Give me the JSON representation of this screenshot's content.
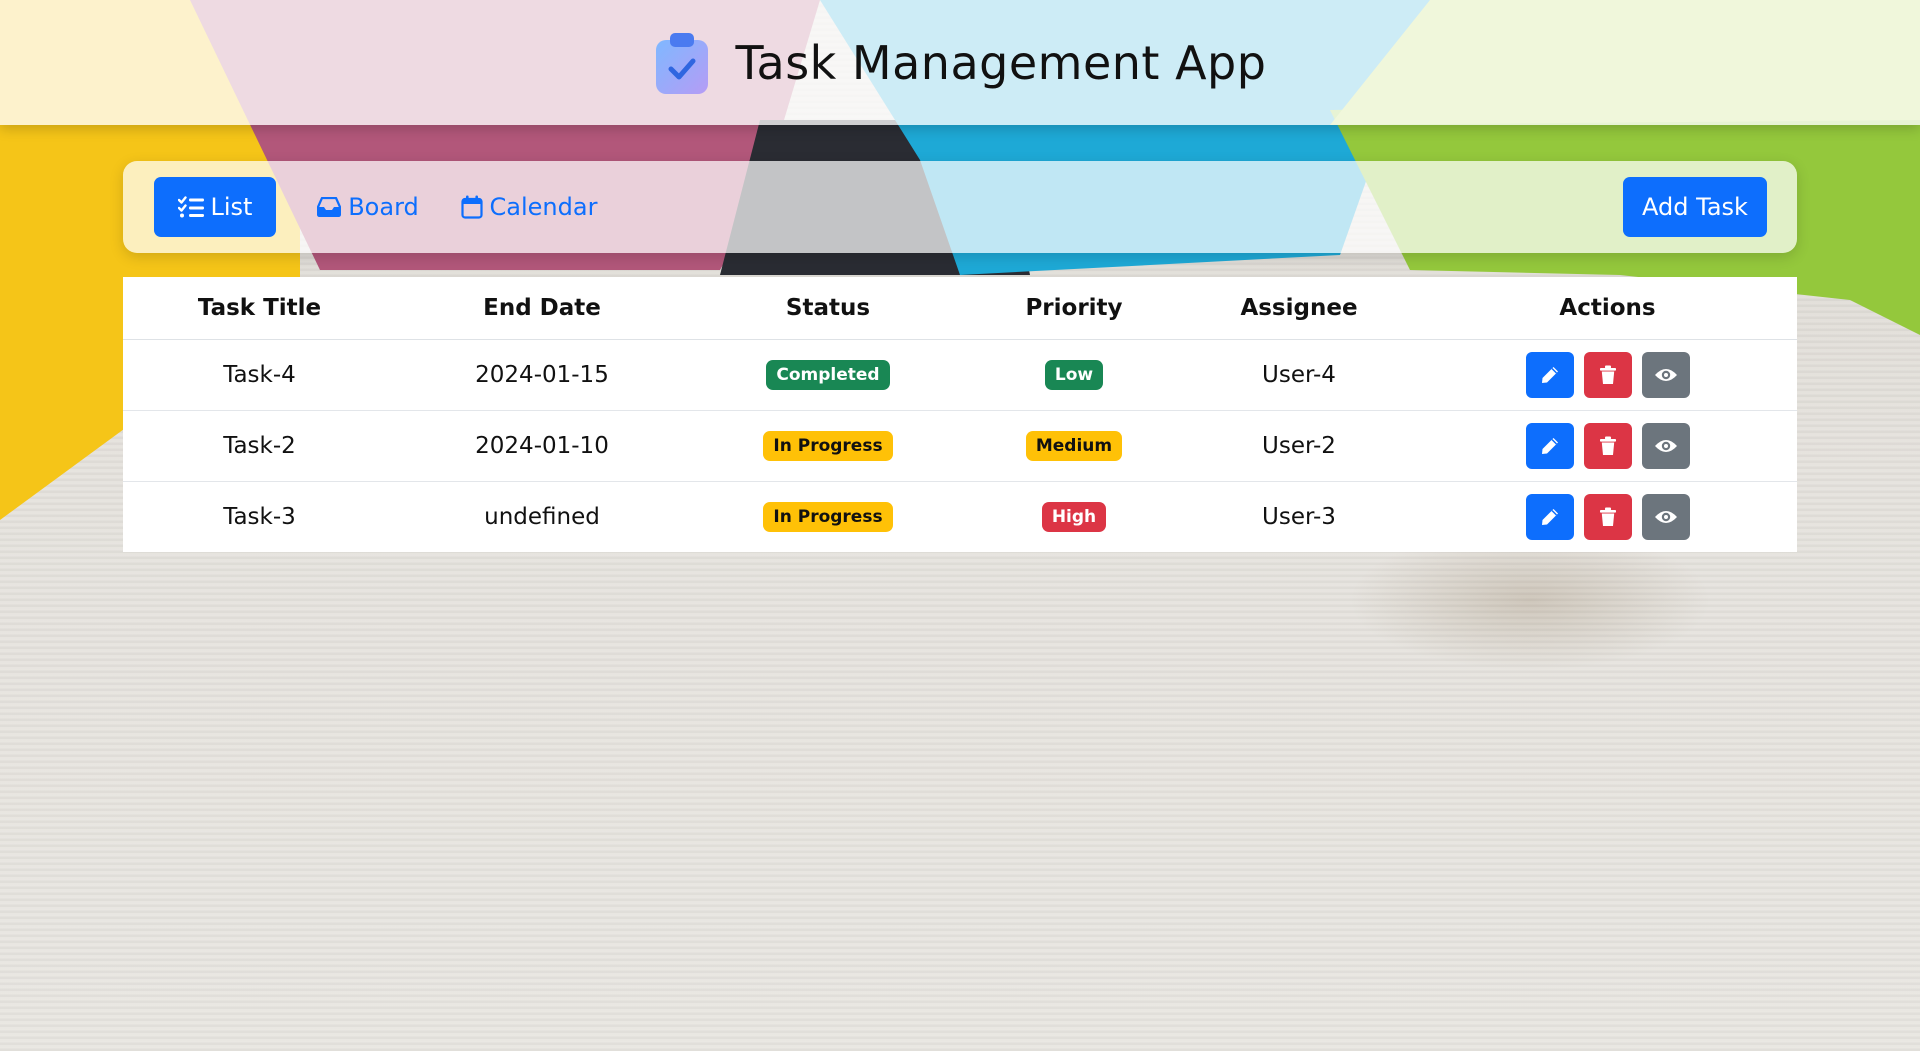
{
  "header": {
    "title": "Task Management App",
    "logo_icon": "clipboard-check-icon"
  },
  "toolbar": {
    "views": [
      {
        "label": "List",
        "icon": "list-check-icon",
        "active": true
      },
      {
        "label": "Board",
        "icon": "inbox-icon",
        "active": false
      },
      {
        "label": "Calendar",
        "icon": "calendar-icon",
        "active": false
      }
    ],
    "add_task_label": "Add Task"
  },
  "table": {
    "headers": [
      "Task Title",
      "End Date",
      "Status",
      "Priority",
      "Assignee",
      "Actions"
    ],
    "rows": [
      {
        "title": "Task-4",
        "end_date": "2024-01-15",
        "status": "Completed",
        "priority": "Low",
        "assignee": "User-4"
      },
      {
        "title": "Task-2",
        "end_date": "2024-01-10",
        "status": "In Progress",
        "priority": "Medium",
        "assignee": "User-2"
      },
      {
        "title": "Task-3",
        "end_date": "undefined",
        "status": "In Progress",
        "priority": "High",
        "assignee": "User-3"
      }
    ],
    "action_icons": [
      "pencil-icon",
      "trash-icon",
      "eye-icon"
    ]
  },
  "colors": {
    "primary": "#0d6efd",
    "success": "#198754",
    "warning": "#ffc107",
    "danger": "#dc3545",
    "secondary": "#6c757d"
  }
}
